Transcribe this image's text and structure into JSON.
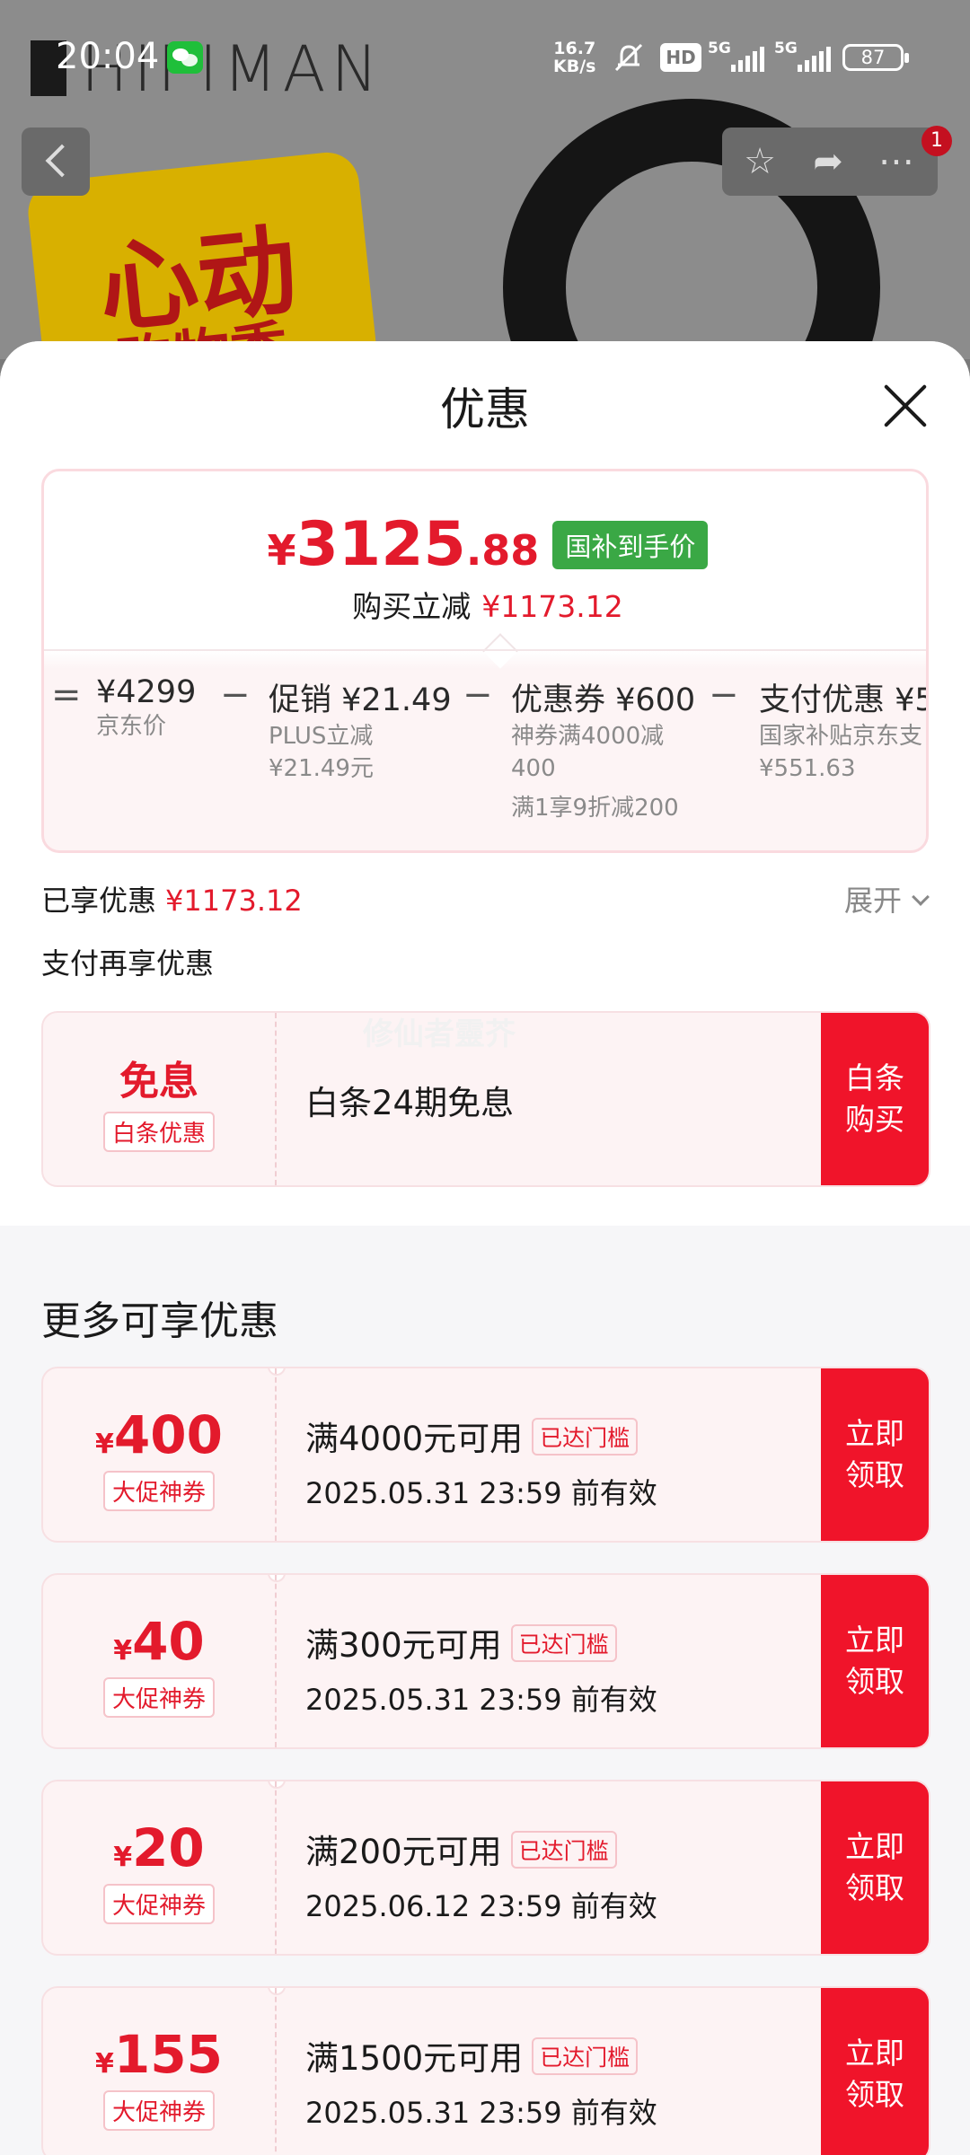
{
  "status_bar": {
    "time": "20:04",
    "net_speed_value": "16.7",
    "net_speed_unit": "KB/s",
    "hd_label": "HD",
    "signal_1": "5G",
    "signal_2": "5G",
    "battery": "87",
    "icons": [
      "wechat-icon",
      "mute-icon",
      "hd-icon",
      "signal-icon",
      "battery-icon"
    ]
  },
  "background": {
    "brand": "HIFIMAN",
    "badge_line1": "心动",
    "badge_line2": "购物季",
    "nav_icons": [
      "back-icon",
      "star-icon",
      "share-icon",
      "more-icon"
    ],
    "notification_count": "1"
  },
  "sheet": {
    "title": "优惠",
    "final_price": {
      "currency": "¥",
      "integer": "3125",
      "decimal": ".88",
      "tag": "国补到手价"
    },
    "reduce": {
      "label": "购买立减",
      "amount": "¥1173.12"
    },
    "breakdown": [
      {
        "op": "=",
        "label": "¥4299",
        "sub1": "京东价",
        "sub2": "",
        "sub3": ""
      },
      {
        "op": "−",
        "label": "促销 ¥21.49",
        "sub1": "PLUS立减",
        "sub2": "¥21.49元",
        "sub3": ""
      },
      {
        "op": "−",
        "label": "优惠券 ¥600",
        "sub1": "神券满4000减",
        "sub2": "400",
        "sub3": "满1享9折减200"
      },
      {
        "op": "−",
        "label": "支付优惠 ¥5",
        "sub1": "国家补贴京东支",
        "sub2": "¥551.63",
        "sub3": ""
      }
    ],
    "enjoyed": {
      "label": "已享优惠",
      "amount": "¥1173.12"
    },
    "expand_label": "展开",
    "pay_more_label": "支付再享优惠",
    "interest_free": {
      "main": "免息",
      "tag": "白条优惠",
      "desc": "白条24期免息",
      "cta_line1": "白条",
      "cta_line2": "购买"
    },
    "watermark": "修仙者靈芥",
    "more_title": "更多可享优惠",
    "coupons": [
      {
        "currency": "¥",
        "amount": "400",
        "kind": "大促神券",
        "title": "满4000元可用",
        "tag": "已达门槛",
        "date": "2025.05.31 23:59 前有效",
        "cta_line1": "立即",
        "cta_line2": "领取"
      },
      {
        "currency": "¥",
        "amount": "40",
        "kind": "大促神券",
        "title": "满300元可用",
        "tag": "已达门槛",
        "date": "2025.05.31 23:59 前有效",
        "cta_line1": "立即",
        "cta_line2": "领取"
      },
      {
        "currency": "¥",
        "amount": "20",
        "kind": "大促神券",
        "title": "满200元可用",
        "tag": "已达门槛",
        "date": "2025.06.12 23:59 前有效",
        "cta_line1": "立即",
        "cta_line2": "领取"
      },
      {
        "currency": "¥",
        "amount": "155",
        "kind": "大促神券",
        "title": "满1500元可用",
        "tag": "已达门槛",
        "date": "2025.05.31 23:59 前有效",
        "cta_line1": "立即",
        "cta_line2": "领取"
      }
    ]
  },
  "colors": {
    "accent_red": "#e31a2c",
    "cta_red": "#f0142a",
    "subsidy_green": "#3aa845"
  }
}
